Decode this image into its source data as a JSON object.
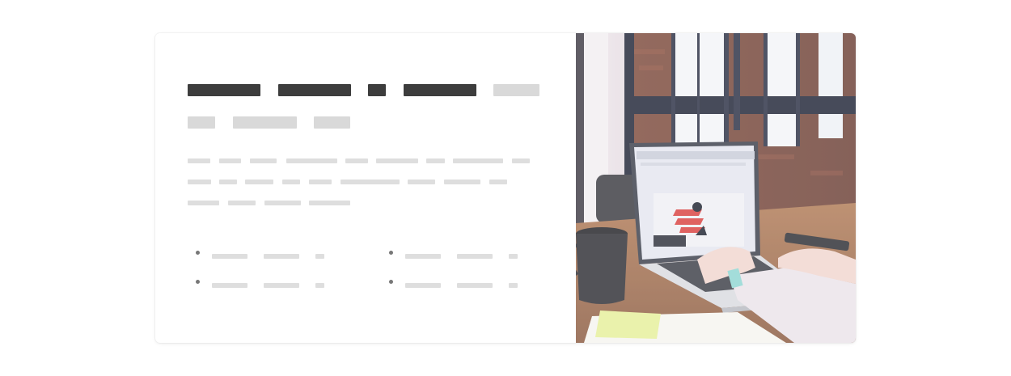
{
  "card": {
    "heading_placeholder": "",
    "body_placeholder": "",
    "feature_list_placeholder": ""
  },
  "photo": {
    "alt": "",
    "colors": {
      "wall": "#7a4a3a",
      "window": "#e8eef5",
      "window_frame": "#1f2436",
      "desk": "#9a6a4a",
      "laptop": "#c9ccd2",
      "screen": "#e4e6ef",
      "logo_red": "#d8403f",
      "logo_dark": "#1e2330",
      "mug": "#2a2a2e",
      "sleeve": "#e9e3ea",
      "hand": "#f1d6cf",
      "sticky": "#e6f09a"
    }
  }
}
